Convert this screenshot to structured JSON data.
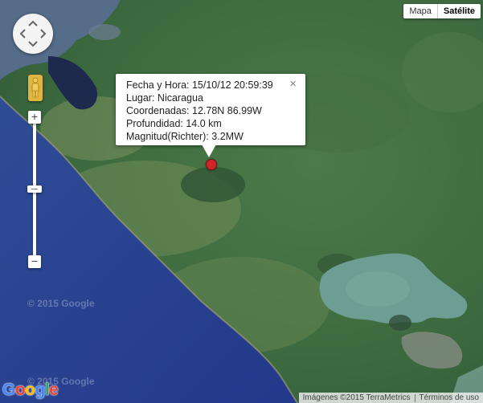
{
  "map_type": {
    "map": "Mapa",
    "satellite": "Satélite",
    "selected": "Satélite"
  },
  "controls": {
    "pan": "pan-control",
    "pegman": "pegman-icon",
    "zoom_in": "+",
    "zoom_out": "−",
    "zoom_level_fraction": 0.5
  },
  "info_window": {
    "line1": "Fecha y Hora: 15/10/12 20:59:39",
    "line2": "Lugar: Nicaragua",
    "line3": "Coordenadas: 12.78N 86.99W",
    "line4": "Profundidad: 14.0 km",
    "line5": "Magnitud(Richter): 3.2MW",
    "close": "×"
  },
  "marker": {
    "color": "#d0232a"
  },
  "watermarks": {
    "google_1": "© 2015 Google",
    "google_2": "© 2015 Google"
  },
  "logo": {
    "g": "G",
    "o1": "o",
    "o2": "o",
    "g2": "g",
    "l": "l",
    "e": "e"
  },
  "attribution": {
    "imagery": "Imágenes ©2015 TerraMetrics",
    "terms": "Términos de uso"
  }
}
